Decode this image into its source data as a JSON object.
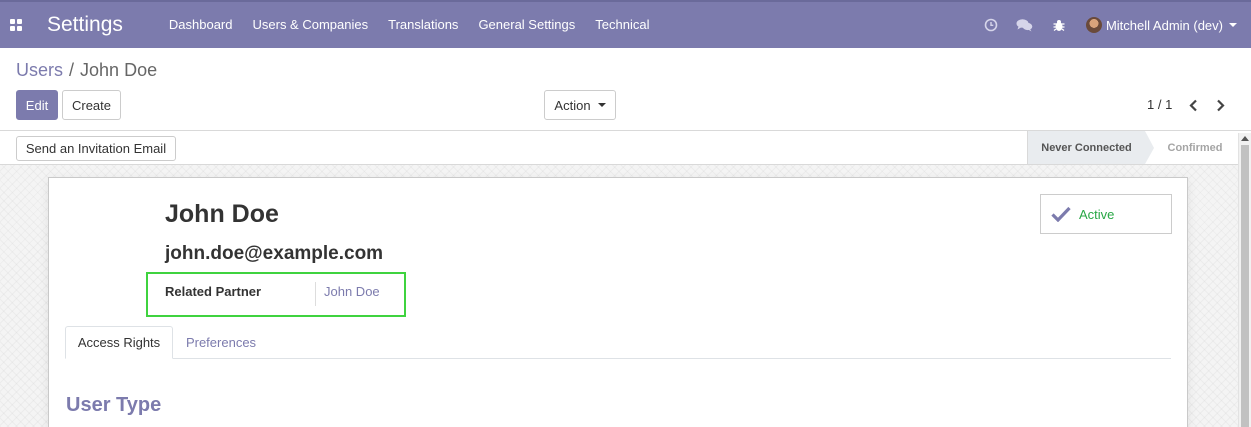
{
  "navbar": {
    "app_title": "Settings",
    "menu": [
      "Dashboard",
      "Users & Companies",
      "Translations",
      "General Settings",
      "Technical"
    ],
    "user": "Mitchell Admin (dev)",
    "background_color": "#7c7bad"
  },
  "breadcrumb": {
    "parent": "Users",
    "separator": "/",
    "current": "John Doe"
  },
  "toolbar": {
    "edit_label": "Edit",
    "create_label": "Create",
    "action_label": "Action",
    "pager": "1 / 1"
  },
  "statusbar": {
    "invite_label": "Send an Invitation Email",
    "stages": [
      "Never Connected",
      "Confirmed"
    ],
    "current_stage": "Never Connected"
  },
  "form": {
    "name": "John Doe",
    "email": "john.doe@example.com",
    "related_partner_label": "Related Partner",
    "related_partner_value": "John Doe",
    "active_label": "Active",
    "tabs": [
      "Access Rights",
      "Preferences"
    ],
    "active_tab": "Access Rights",
    "section_title": "User Type"
  },
  "colors": {
    "brand": "#7c7bad",
    "active_green": "#28a745",
    "highlight_green": "#3fd33f"
  },
  "icons": [
    "apps-grid-icon",
    "clock-icon",
    "chat-icon",
    "bug-icon",
    "avatar",
    "chevron-left-icon",
    "chevron-right-icon",
    "checkmark-icon"
  ]
}
